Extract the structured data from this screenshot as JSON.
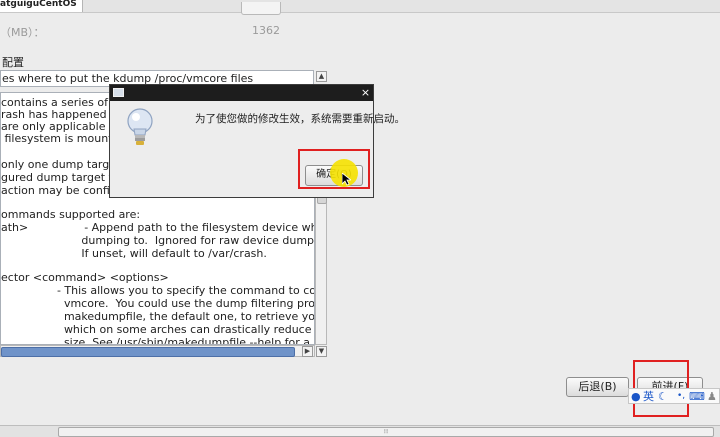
{
  "window": {
    "tab_title": "atguiguCentOS"
  },
  "memory": {
    "label": "（MB）：",
    "value": "1362"
  },
  "config": {
    "label": "配置",
    "input_value": "es where to put the kdump /proc/vmcore files"
  },
  "text_lines": [
    "contains a series of co",
    "rash has happened an",
    "are only applicable to",
    " filesystem is mounte",
    "",
    "only one dump target",
    "gured dump target fai",
    "action may be configu",
    "",
    "ommands supported are:",
    "ath>                - Append path to the filesystem device wh",
    "                       dumping to.  Ignored for raw device dumps.",
    "                       If unset, will default to /var/crash.",
    "",
    "ector <command> <options>",
    "                - This allows you to specify the command to copy",
    "                  vmcore.  You could use the dump filtering program",
    "                  makedumpfile, the default one, to retrieve your",
    "                  which on some arches can drastically reduce core",
    "                  size. See /usr/sbin/makedumpfile --help for a list o"
  ],
  "buttons": {
    "back": "后退(B)",
    "forward": "前进(F)"
  },
  "dialog": {
    "message": "为了使您做的修改生效，系统需要重新启动。",
    "ok": "确定(O)",
    "close": "×"
  },
  "ime": {
    "lang": "英"
  },
  "bottom_scroll_grip": "⦙⦙⦙",
  "icons": {
    "info": "lightbulb-icon",
    "dialog_window": "window-icon",
    "scroll_up": "▲",
    "scroll_down": "▼",
    "scroll_left": "◀",
    "scroll_right": "▶",
    "moon": "☾",
    "keyboard": "⌨"
  },
  "colors": {
    "highlight_red": "#e02020",
    "cursor_yellow": "#f5e100",
    "scroll_thumb_blue": "#6f93c9"
  }
}
